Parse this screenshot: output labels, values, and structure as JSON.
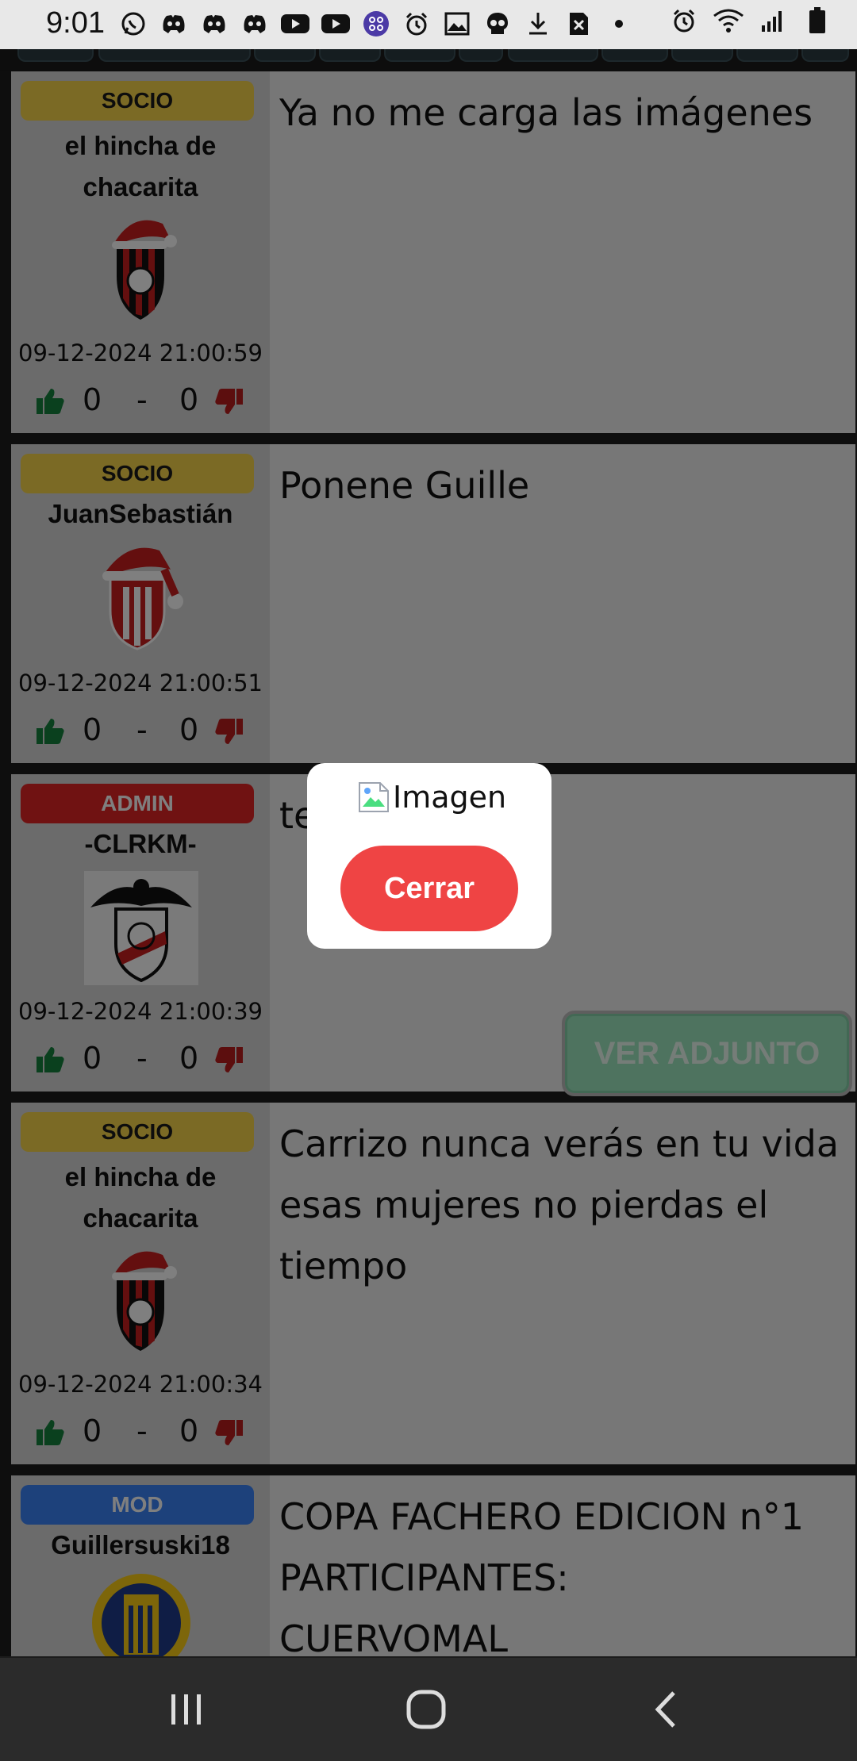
{
  "status_bar": {
    "time": "9:01",
    "left_icons": [
      "whatsapp-icon",
      "discord-icon",
      "discord-icon",
      "discord-icon",
      "youtube-icon",
      "youtube-icon",
      "app-icon",
      "alarm-icon",
      "gallery-icon",
      "skull-icon",
      "download-icon",
      "close-box-icon",
      "dot-icon"
    ],
    "right_icons": [
      "alarm-icon",
      "wifi-icon",
      "signal-icon",
      "battery-icon"
    ]
  },
  "posts": [
    {
      "badge": "SOCIO",
      "badge_type": "socio",
      "username_lines": [
        "el hincha de",
        "chacarita"
      ],
      "avatar": "chacarita-shield-santa-hat",
      "date": "09-12-2024 21:00:59",
      "likes": "0",
      "separator": "-",
      "dislikes": "0",
      "message": "Ya no me carga las imágenes"
    },
    {
      "badge": "SOCIO",
      "badge_type": "socio",
      "username_lines": [
        "JuanSebastián"
      ],
      "avatar": "estudiantes-shield-santa-hat",
      "date": "09-12-2024 21:00:51",
      "likes": "0",
      "separator": "-",
      "dislikes": "0",
      "message": "Ponene Guille"
    },
    {
      "badge": "ADMIN",
      "badge_type": "admin",
      "username_lines": [
        "-CLRKM-"
      ],
      "avatar": "river-shield-eagle",
      "date": "09-12-2024 21:00:39",
      "likes": "0",
      "separator": "-",
      "dislikes": "0",
      "message": "te",
      "attachment_label": "VER ADJUNTO"
    },
    {
      "badge": "SOCIO",
      "badge_type": "socio",
      "username_lines": [
        "el hincha de",
        "chacarita"
      ],
      "avatar": "chacarita-shield-santa-hat",
      "date": "09-12-2024 21:00:34",
      "likes": "0",
      "separator": "-",
      "dislikes": "0",
      "message": "Carrizo nunca verás en tu vida esas mujeres no pierdas el tiempo"
    },
    {
      "badge": "MOD",
      "badge_type": "mod",
      "username_lines": [
        "Guillersuski18"
      ],
      "avatar": "rosario-central-shield",
      "message_lines": [
        "COPA FACHERO EDICION n°1",
        "PARTICIPANTES:",
        "CUERVOMAL"
      ]
    }
  ],
  "modal": {
    "image_alt": "Imagen",
    "close_label": "Cerrar"
  },
  "nav_bar": {
    "recents": "recents-icon",
    "home": "home-icon",
    "back": "back-icon"
  }
}
